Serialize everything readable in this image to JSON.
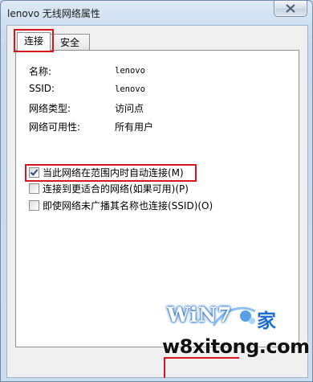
{
  "window": {
    "title": "lenovo 无线网络属性"
  },
  "tabs": [
    {
      "label": "连接",
      "active": true
    },
    {
      "label": "安全",
      "active": false
    }
  ],
  "properties": [
    {
      "label": "名称:",
      "value": "lenovo"
    },
    {
      "label": "SSID:",
      "value": "lenovo"
    },
    {
      "label": "网络类型:",
      "value": "访问点"
    },
    {
      "label": "网络可用性:",
      "value": "所有用户"
    }
  ],
  "options": [
    {
      "label": "当此网络在范围内时自动连接(M)",
      "checked": true
    },
    {
      "label": "连接到更适合的网络(如果可用)(P)",
      "checked": false
    },
    {
      "label": "即使网络未广播其名称也连接(SSID)(O)",
      "checked": false
    }
  ],
  "watermark": {
    "brand": "WiN7",
    "brand_suffix": "家",
    "url": "w8xitong.com"
  },
  "colors": {
    "highlight": "#d8161f",
    "title_bar": "#cfe0f1"
  },
  "icons": {
    "close": "close-icon"
  }
}
